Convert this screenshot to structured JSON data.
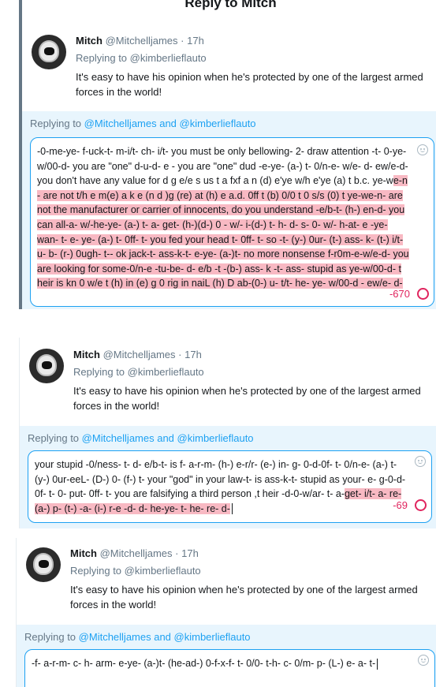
{
  "modal": {
    "title": "Reply to Mitch"
  },
  "panels": [
    {
      "tweet": {
        "name": "Mitch",
        "handle": "@Mitchelljames",
        "dot": "·",
        "time": "17h",
        "replying_to": "Replying to @kimberlieflauto",
        "text": "It's easy to have his opinion when he's protected by one of the largest armed forces in the world!"
      },
      "composer": {
        "replying_prefix": "Replying to",
        "replying_users": "@Mitchelljames and @kimberlieflauto",
        "draft_normal": "-0-me-ye- f-uck-t- m-i/t- ch- i/t-   you must be only bellowing- 2- draw attention -t- 0-ye- w/00-d-    you are \"one\" d-u-d- e -    you are \"one\" dud  -e-ye- (a-) t- 0/n-e- w/e- d- ew/e-d-    you don't have any value for d g e/e s us t a fxf a n (d) e'ye w/h e'ye (a) t   b.c. ye-w",
        "draft_over": "e-n - are not  t/h e m(e) a k e (n d )g (re) at (h) e a.d. 0ff t (b) 0/0 t 0 s/s (0) t   ye-we-n- are not the manufacturer or carrier of innocents, do you understand -e/b-t- (h-) en-d-  you can all-a- w/-he-ye- (a-) t-  a- get- (h-)(d-) 0 - w/- i-(d-) t- h- d-  s- 0- w/- h-at- e -ye- wan- t-  e- ye- (a-) t- 0ff- t-    you fed your head t- 0ff- t-    so -t- (y-) 0ur- (t-) ass- k- (t-) i/t- u- b- (r-) 0ugh- t-- ok jack-t- ass-k-t- e-ye- (a-)t-   no more nonsense f-r0m-e-w/e-d-     you are looking for some-0/n-e -tu-be- d- e/b -t -(b-) ass- k -t- ass- stupid as ye-w/00-d-    t heir is kn 0 w/e t (h) in (e) g 0 rig in naiL (h) D  ab-(0-) u- t/t- he- ye- w/00-d - ew/e- d- ",
        "char_count": "-670"
      }
    },
    {
      "tweet": {
        "name": "Mitch",
        "handle": "@Mitchelljames",
        "dot": "·",
        "time": "17h",
        "replying_to": "Replying to @kimberlieflauto",
        "text": "It's easy to have his opinion when he's protected by one of the largest armed forces in the world!"
      },
      "composer": {
        "replying_prefix": "Replying to",
        "replying_users": "@Mitchelljames and @kimberlieflauto",
        "draft_normal": "your stupid -0/ness- t- d- e/b-t-  is f- a-r-m- (h-) e-r/r- (e-) in- g- 0-d-0f- t- 0/n-e- (a-) t- (y-) 0ur-eeL- (D-) 0- (f-) t-    your \"god\" in your law-t- is ass-k-t- stupid as your- e- g-0-d- 0f- t-  0- put- 0ff- t-  you are falsifying a third person ,t heir -d-0-w/ar- t- a-",
        "draft_over": "get- i/t- a- re- (a-) p- (t-) -a- (i-) r-e -d- d- he-ye- t- he- re- d-",
        "char_count": "-69"
      }
    },
    {
      "tweet": {
        "name": "Mitch",
        "handle": "@Mitchelljames",
        "dot": "·",
        "time": "17h",
        "replying_to": "Replying to @kimberlieflauto",
        "text": "It's easy to have his opinion when he's protected by one of the largest armed forces in the world!"
      },
      "composer": {
        "replying_prefix": "Replying to",
        "replying_users": "@Mitchelljames and @kimberlieflauto",
        "draft_normal": "-f- a-r-m- c- h- arm- e-ye- (a-)t- (he-ad-) 0-f-x-f- t- 0/0- t-h- c- 0/m- p- (L-) e- a- t-"
      }
    }
  ],
  "colors": {
    "accent": "#1da1f2",
    "composer_bg": "#e8f5fd",
    "overflow_highlight": "#f8b9c3",
    "over_limit": "#e0245e",
    "muted": "#657786"
  }
}
